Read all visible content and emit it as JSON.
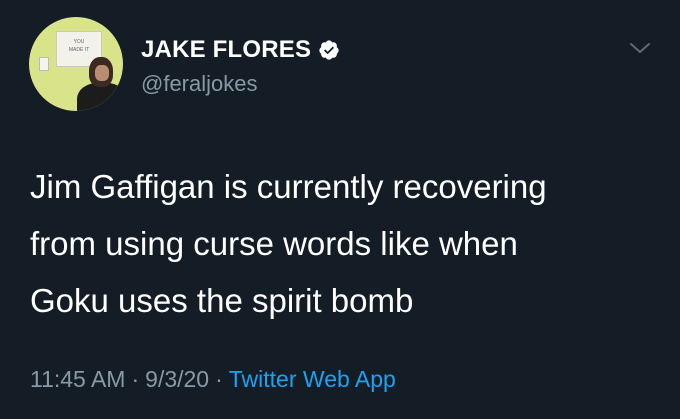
{
  "tweet": {
    "display_name": "JAKE FLORES",
    "handle": "@feraljokes",
    "verified": true,
    "text": "Jim Gaffigan is currently recovering\nfrom using curse words like when\nGoku uses the spirit bomb",
    "time": "11:45 AM",
    "date": "9/3/20",
    "separator": "·",
    "source": "Twitter Web App"
  },
  "icons": {
    "verified": "verified-badge-icon",
    "more": "chevron-down-icon"
  },
  "colors": {
    "background": "#141d26",
    "text": "#ffffff",
    "secondary": "#8899a6",
    "accent": "#1da1f2"
  }
}
